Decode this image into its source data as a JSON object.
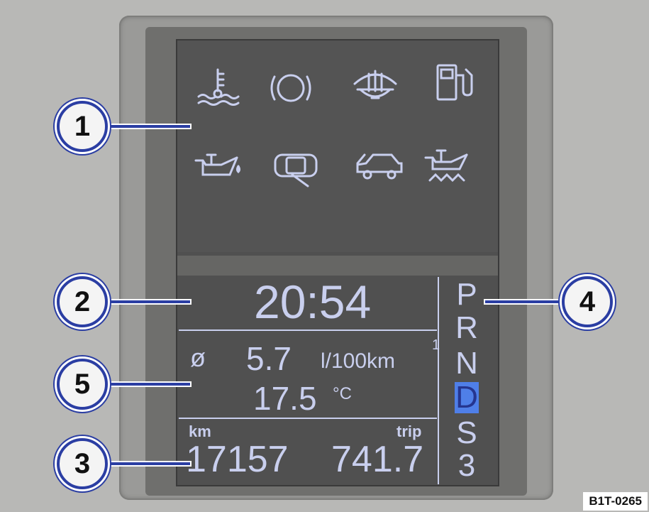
{
  "display": {
    "clock": "20:54",
    "consumption": {
      "symbol": "ø",
      "value": "5.7",
      "unit": "l/100km",
      "memory": "1"
    },
    "temperature": {
      "value": "17.5",
      "unit": "°C"
    },
    "odometer": {
      "label": "km",
      "value": "17157"
    },
    "trip": {
      "label": "trip",
      "value": "741.7"
    },
    "gears": [
      "P",
      "R",
      "N",
      "D",
      "S",
      "3"
    ],
    "selected_gear": "D"
  },
  "warning_icons": [
    "coolant-temperature-icon",
    "brake-warning-icon",
    "washer-fluid-icon",
    "fuel-level-icon",
    "oil-pressure-icon",
    "door-open-icon",
    "trunk-open-icon",
    "oil-level-icon"
  ],
  "callouts": [
    "1",
    "2",
    "3",
    "4",
    "5"
  ],
  "figure_code": "B1T-0265",
  "colors": {
    "display_text": "#c9cfee",
    "callout_ring": "#2b3ea3",
    "selected_gear": "#4f7fe8"
  }
}
